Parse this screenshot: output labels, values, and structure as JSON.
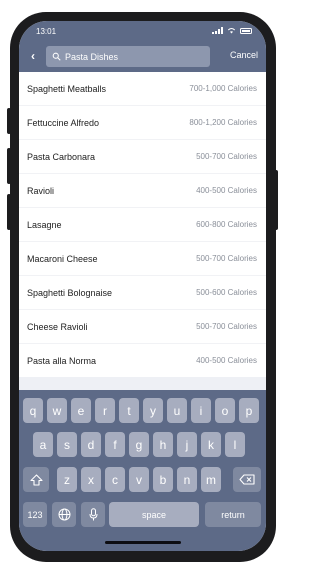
{
  "status_bar": {
    "time": "13:01"
  },
  "header": {
    "search_value": "Pasta Dishes",
    "cancel_label": "Cancel"
  },
  "results": [
    {
      "name": "Spaghetti Meatballs",
      "calories": "700-1,000 Calories"
    },
    {
      "name": "Fettuccine Alfredo",
      "calories": "800-1,200 Calories"
    },
    {
      "name": "Pasta Carbonara",
      "calories": "500-700 Calories"
    },
    {
      "name": "Ravioli",
      "calories": "400-500 Calories"
    },
    {
      "name": "Lasagne",
      "calories": "600-800 Calories"
    },
    {
      "name": "Macaroni Cheese",
      "calories": "500-700 Calories"
    },
    {
      "name": "Spaghetti Bolognaise",
      "calories": "500-600 Calories"
    },
    {
      "name": "Cheese Ravioli",
      "calories": "500-700 Calories"
    },
    {
      "name": "Pasta alla Norma",
      "calories": "400-500 Calories"
    }
  ],
  "keyboard": {
    "row1": [
      "q",
      "w",
      "e",
      "r",
      "t",
      "y",
      "u",
      "i",
      "o",
      "p"
    ],
    "row2": [
      "a",
      "s",
      "d",
      "f",
      "g",
      "h",
      "j",
      "k",
      "l"
    ],
    "row3": [
      "z",
      "x",
      "c",
      "v",
      "b",
      "n",
      "m"
    ],
    "numbers_label": "123",
    "space_label": "space",
    "return_label": "return"
  },
  "colors": {
    "header_bg": "#5d6a87",
    "search_bg": "#8d97ae",
    "key_bg": "#a7adbf",
    "function_key_bg": "#7f89a0"
  }
}
